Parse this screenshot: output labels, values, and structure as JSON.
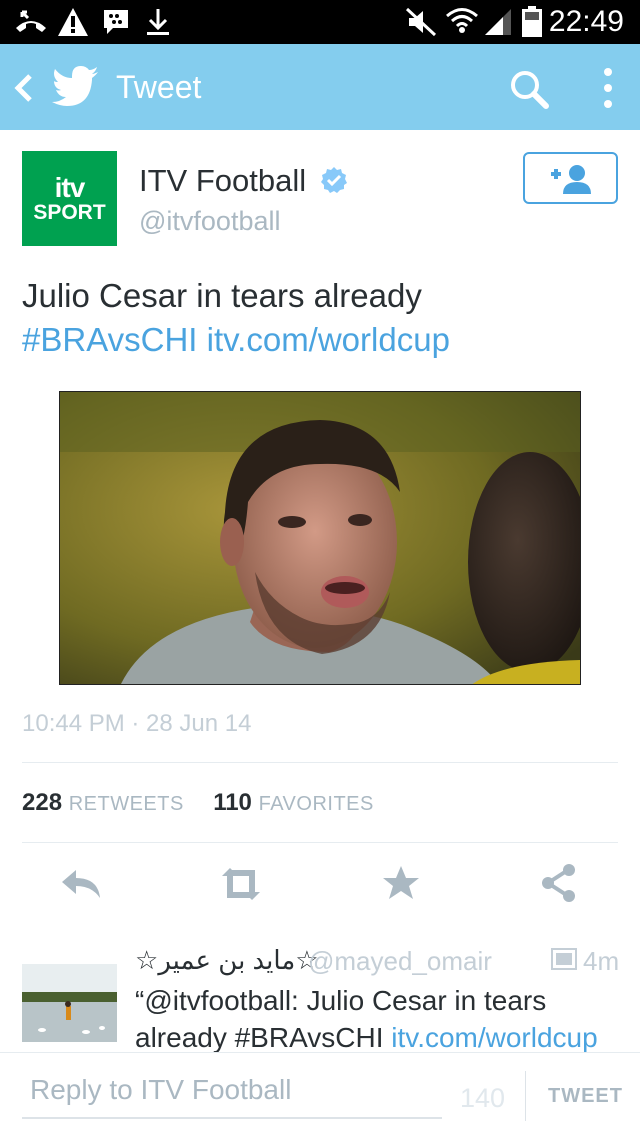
{
  "status_bar": {
    "time": "22:49",
    "icons": [
      "missed-call-icon",
      "warning-icon",
      "bbm-icon",
      "download-icon",
      "mute-icon",
      "wifi-icon",
      "signal-icon",
      "battery-icon"
    ]
  },
  "app_bar": {
    "title": "Tweet",
    "background": "#84cdee",
    "icons": [
      "back-icon",
      "twitter-bird-icon",
      "search-icon",
      "overflow-menu-icon"
    ]
  },
  "tweet": {
    "avatar": {
      "line1": "itv",
      "line2": "SPORT",
      "color": "#00a150"
    },
    "author_name": "ITV Football",
    "author_handle": "@itvfootball",
    "verified": true,
    "text": "Julio Cesar in tears already",
    "hashtag": "#BRAvsCHI",
    "link": "itv.com/worldcup",
    "timestamp": "10:44 PM · 28 Jun 14",
    "retweets_count": "228",
    "retweets_label": "RETWEETS",
    "favorites_count": "110",
    "favorites_label": "FAVORITES",
    "actions": [
      "reply-icon",
      "retweet-icon",
      "favorite-icon",
      "share-icon"
    ]
  },
  "reply": {
    "name": "☆مايد بن عمير☆",
    "handle": "@mayed_omair",
    "time": "4m",
    "text": "“@itvfootball: Julio Cesar in tears already #BRAvsCHI",
    "link": "itv.com/worldcup"
  },
  "composer": {
    "placeholder": "Reply to ITV Football",
    "char_count": "140",
    "button_label": "TWEET"
  },
  "colors": {
    "link": "#4aa3df",
    "text": "#292f33",
    "muted": "#aab8c2"
  }
}
